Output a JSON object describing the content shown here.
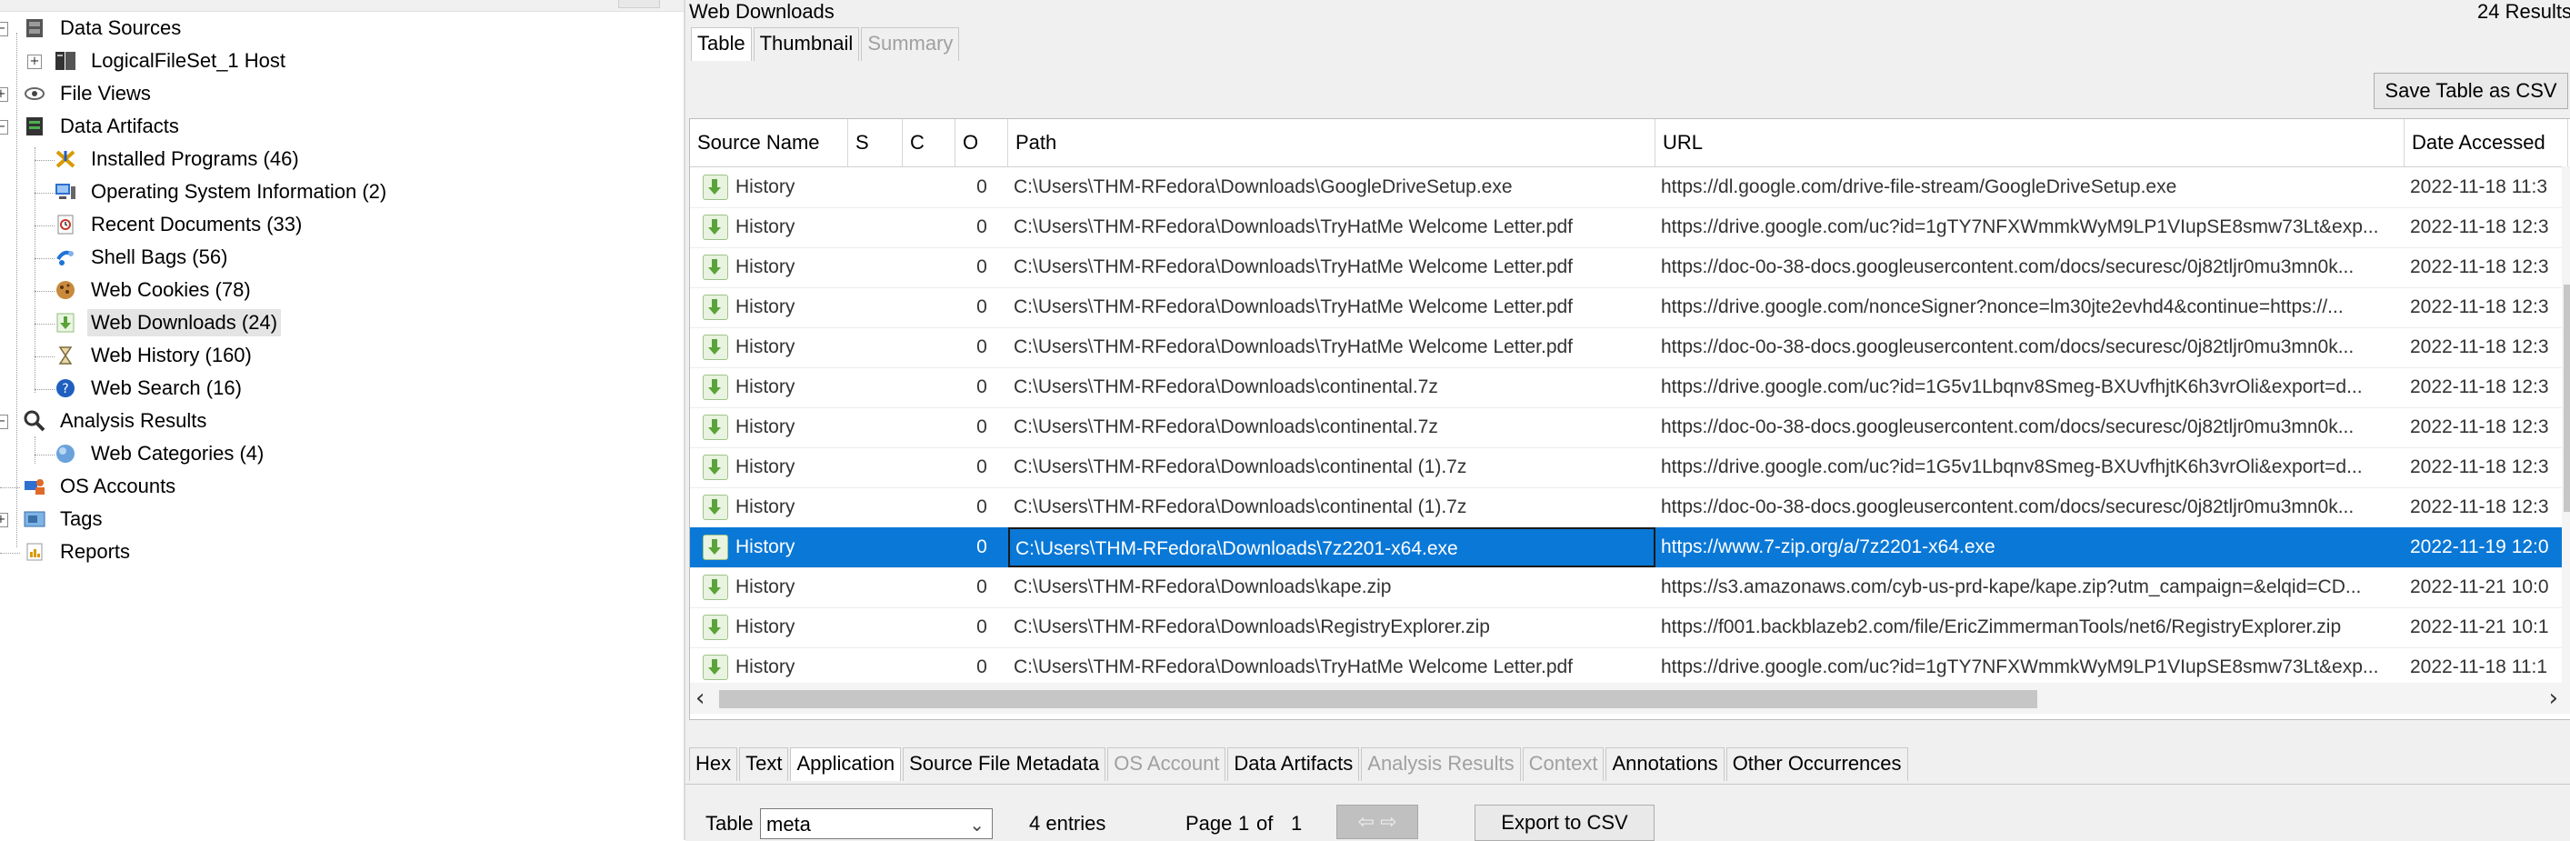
{
  "tree": {
    "items": [
      {
        "label": "Data Sources",
        "icon": "database-icon",
        "level": 0,
        "expander": "−"
      },
      {
        "label": "LogicalFileSet_1 Host",
        "icon": "host-icon",
        "level": 1,
        "expander": "+"
      },
      {
        "label": "File Views",
        "icon": "eye-icon",
        "level": 0,
        "expander": "+"
      },
      {
        "label": "Data Artifacts",
        "icon": "artifacts-icon",
        "level": 0,
        "expander": "−"
      },
      {
        "label": "Installed Programs (46)",
        "icon": "install-icon",
        "level": 1
      },
      {
        "label": "Operating System Information (2)",
        "icon": "computer-icon",
        "level": 1
      },
      {
        "label": "Recent Documents (33)",
        "icon": "clock-doc-icon",
        "level": 1
      },
      {
        "label": "Shell Bags (56)",
        "icon": "shellbag-icon",
        "level": 1
      },
      {
        "label": "Web Cookies (78)",
        "icon": "cookie-icon",
        "level": 1
      },
      {
        "label": "Web Downloads (24)",
        "icon": "download-icon",
        "level": 1,
        "selected": true
      },
      {
        "label": "Web History (160)",
        "icon": "hourglass-icon",
        "level": 1
      },
      {
        "label": "Web Search (16)",
        "icon": "help-globe-icon",
        "level": 1
      },
      {
        "label": "Analysis Results",
        "icon": "magnifier-icon",
        "level": 0,
        "expander": "−"
      },
      {
        "label": "Web Categories (4)",
        "icon": "globe-icon",
        "level": 1
      },
      {
        "label": "OS Accounts",
        "icon": "users-icon",
        "level": 0
      },
      {
        "label": "Tags",
        "icon": "tag-icon",
        "level": 0,
        "expander": "+"
      },
      {
        "label": "Reports",
        "icon": "report-icon",
        "level": 0
      }
    ]
  },
  "viewer": {
    "title": "Web Downloads",
    "results_count": "24 Results",
    "tabs": [
      {
        "label": "Table",
        "state": "active"
      },
      {
        "label": "Thumbnail",
        "state": "normal"
      },
      {
        "label": "Summary",
        "state": "disabled"
      }
    ],
    "save_button": "Save Table as CSV",
    "columns": [
      "Source Name",
      "S",
      "C",
      "O",
      "Path",
      "URL",
      "Date Accessed"
    ],
    "rows": [
      {
        "source": "History",
        "o": "0",
        "path": "C:\\Users\\THM-RFedora\\Downloads\\GoogleDriveSetup.exe",
        "url": "https://dl.google.com/drive-file-stream/GoogleDriveSetup.exe",
        "date": "2022-11-18 11:3"
      },
      {
        "source": "History",
        "o": "0",
        "path": "C:\\Users\\THM-RFedora\\Downloads\\TryHatMe Welcome Letter.pdf",
        "url": "https://drive.google.com/uc?id=1gTY7NFXWmmkWyM9LP1VIupSE8smw73Lt&exp...",
        "date": "2022-11-18 12:3"
      },
      {
        "source": "History",
        "o": "0",
        "path": "C:\\Users\\THM-RFedora\\Downloads\\TryHatMe Welcome Letter.pdf",
        "url": "https://doc-0o-38-docs.googleusercontent.com/docs/securesc/0j82tljr0mu3mn0k...",
        "date": "2022-11-18 12:3"
      },
      {
        "source": "History",
        "o": "0",
        "path": "C:\\Users\\THM-RFedora\\Downloads\\TryHatMe Welcome Letter.pdf",
        "url": "https://drive.google.com/nonceSigner?nonce=lm30jte2evhd4&continue=https://...",
        "date": "2022-11-18 12:3"
      },
      {
        "source": "History",
        "o": "0",
        "path": "C:\\Users\\THM-RFedora\\Downloads\\TryHatMe Welcome Letter.pdf",
        "url": "https://doc-0o-38-docs.googleusercontent.com/docs/securesc/0j82tljr0mu3mn0k...",
        "date": "2022-11-18 12:3"
      },
      {
        "source": "History",
        "o": "0",
        "path": "C:\\Users\\THM-RFedora\\Downloads\\continental.7z",
        "url": "https://drive.google.com/uc?id=1G5v1Lbqnv8Smeg-BXUvfhjtK6h3vrOli&export=d...",
        "date": "2022-11-18 12:3"
      },
      {
        "source": "History",
        "o": "0",
        "path": "C:\\Users\\THM-RFedora\\Downloads\\continental.7z",
        "url": "https://doc-0o-38-docs.googleusercontent.com/docs/securesc/0j82tljr0mu3mn0k...",
        "date": "2022-11-18 12:3"
      },
      {
        "source": "History",
        "o": "0",
        "path": "C:\\Users\\THM-RFedora\\Downloads\\continental (1).7z",
        "url": "https://drive.google.com/uc?id=1G5v1Lbqnv8Smeg-BXUvfhjtK6h3vrOli&export=d...",
        "date": "2022-11-18 12:3"
      },
      {
        "source": "History",
        "o": "0",
        "path": "C:\\Users\\THM-RFedora\\Downloads\\continental (1).7z",
        "url": "https://doc-0o-38-docs.googleusercontent.com/docs/securesc/0j82tljr0mu3mn0k...",
        "date": "2022-11-18 12:3"
      },
      {
        "source": "History",
        "o": "0",
        "path": "C:\\Users\\THM-RFedora\\Downloads\\7z2201-x64.exe",
        "url": "https://www.7-zip.org/a/7z2201-x64.exe",
        "date": "2022-11-19 12:0",
        "selected": true
      },
      {
        "source": "History",
        "o": "0",
        "path": "C:\\Users\\THM-RFedora\\Downloads\\kape.zip",
        "url": "https://s3.amazonaws.com/cyb-us-prd-kape/kape.zip?utm_campaign=&elqid=CD...",
        "date": "2022-11-21 10:0"
      },
      {
        "source": "History",
        "o": "0",
        "path": "C:\\Users\\THM-RFedora\\Downloads\\RegistryExplorer.zip",
        "url": "https://f001.backblazeb2.com/file/EricZimmermanTools/net6/RegistryExplorer.zip",
        "date": "2022-11-21 10:1"
      },
      {
        "source": "History",
        "o": "0",
        "path": "C:\\Users\\THM-RFedora\\Downloads\\TryHatMe Welcome Letter.pdf",
        "url": "https://drive.google.com/uc?id=1gTY7NFXWmmkWyM9LP1VIupSE8smw73Lt&exp...",
        "date": "2022-11-18 11:1"
      }
    ]
  },
  "content_tabs": [
    {
      "label": "Hex",
      "state": "normal"
    },
    {
      "label": "Text",
      "state": "normal"
    },
    {
      "label": "Application",
      "state": "active"
    },
    {
      "label": "Source File Metadata",
      "state": "normal"
    },
    {
      "label": "OS Account",
      "state": "disabled"
    },
    {
      "label": "Data Artifacts",
      "state": "normal"
    },
    {
      "label": "Analysis Results",
      "state": "disabled"
    },
    {
      "label": "Context",
      "state": "disabled"
    },
    {
      "label": "Annotations",
      "state": "normal"
    },
    {
      "label": "Other Occurrences",
      "state": "normal"
    }
  ],
  "bottom": {
    "table_label": "Table",
    "table_select": "meta",
    "entries": "4 entries",
    "page_label": "Page",
    "page_current": "1",
    "page_of": "of",
    "page_total": "1",
    "prev_arrow": "⇦",
    "next_arrow": "⇨",
    "export_button": "Export to CSV"
  }
}
